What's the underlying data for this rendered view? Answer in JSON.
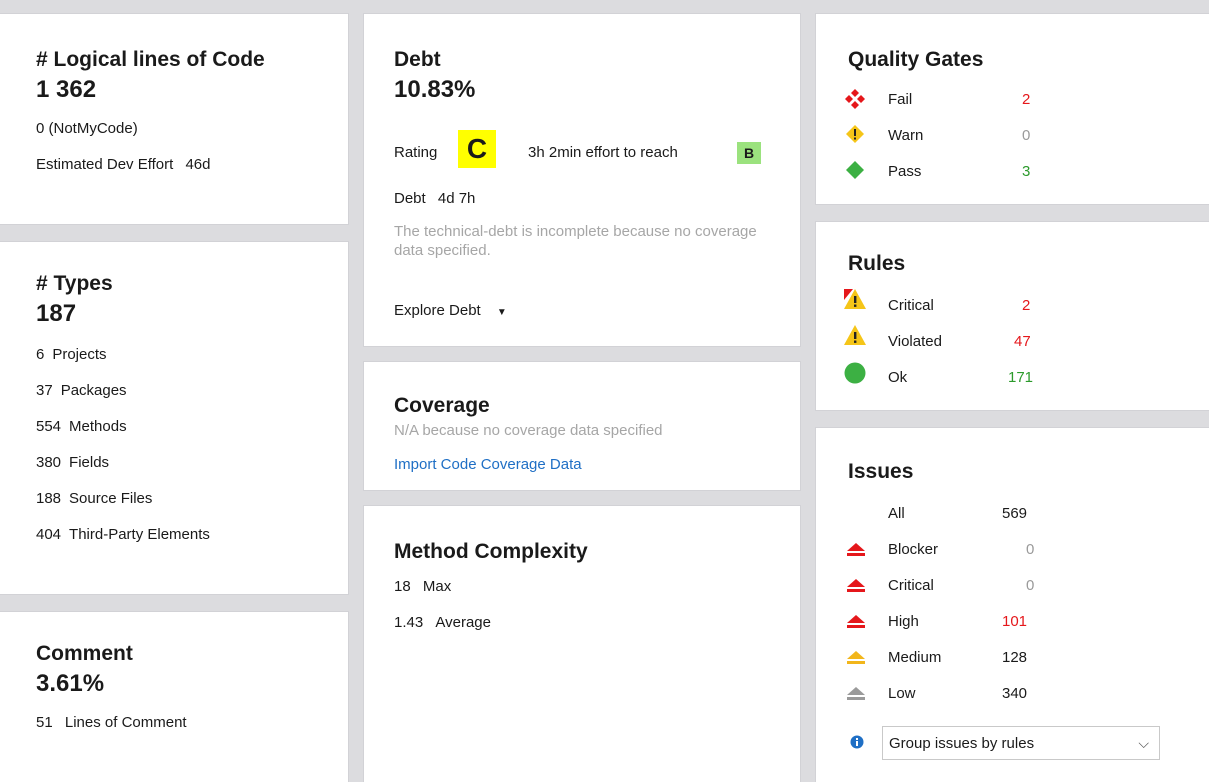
{
  "loc": {
    "title": "# Logical lines of Code",
    "value": "1 362",
    "notmycode": "0  (NotMyCode)",
    "effort_label": "Estimated Dev Effort",
    "effort_value": "46d"
  },
  "types": {
    "title": "# Types",
    "value": "187",
    "items": [
      {
        "count": "6",
        "label": "Projects"
      },
      {
        "count": "37",
        "label": "Packages"
      },
      {
        "count": "554",
        "label": "Methods"
      },
      {
        "count": "380",
        "label": "Fields"
      },
      {
        "count": "188",
        "label": "Source Files"
      },
      {
        "count": "404",
        "label": "Third-Party Elements"
      }
    ]
  },
  "comment": {
    "title": "Comment",
    "value": "3.61%",
    "lines_count": "51",
    "lines_label": "Lines of Comment"
  },
  "debt": {
    "title": "Debt",
    "value": "10.83%",
    "rating_label": "Rating",
    "rating": "C",
    "effort_text": "3h  2min effort to reach",
    "target_rating": "B",
    "debt_label": "Debt",
    "debt_value": "4d  7h",
    "note": "The technical-debt is incomplete because no coverage data specified.",
    "explore_label": "Explore Debt"
  },
  "coverage": {
    "title": "Coverage",
    "note": "N/A because no coverage data specified",
    "import_label": "Import Code Coverage Data"
  },
  "complexity": {
    "title": "Method Complexity",
    "max_value": "18",
    "max_label": "Max",
    "avg_value": "1.43",
    "avg_label": "Average"
  },
  "quality_gates": {
    "title": "Quality Gates",
    "items": [
      {
        "label": "Fail",
        "value": "2",
        "icon": "fail-icon"
      },
      {
        "label": "Warn",
        "value": "0",
        "icon": "warn-icon"
      },
      {
        "label": "Pass",
        "value": "3",
        "icon": "pass-icon"
      }
    ]
  },
  "rules": {
    "title": "Rules",
    "items": [
      {
        "label": "Critical",
        "value": "2",
        "icon": "critical-rule-icon"
      },
      {
        "label": "Violated",
        "value": "47",
        "icon": "violated-rule-icon"
      },
      {
        "label": "Ok",
        "value": "171",
        "icon": "ok-rule-icon"
      }
    ]
  },
  "issues": {
    "title": "Issues",
    "all_label": "All",
    "all_value": "569",
    "items": [
      {
        "label": "Blocker",
        "value": "0",
        "icon": "blocker-icon"
      },
      {
        "label": "Critical",
        "value": "0",
        "icon": "critical-issue-icon"
      },
      {
        "label": "High",
        "value": "101",
        "icon": "high-icon"
      },
      {
        "label": "Medium",
        "value": "128",
        "icon": "medium-icon"
      },
      {
        "label": "Low",
        "value": "340",
        "icon": "low-icon"
      }
    ],
    "group_select": "Group issues by rules"
  },
  "colors": {
    "red": "#e5171b",
    "green": "#2c9a2c",
    "rating_c": "#ffff00",
    "rating_b": "#9be27e",
    "link": "#1f6fc5"
  }
}
